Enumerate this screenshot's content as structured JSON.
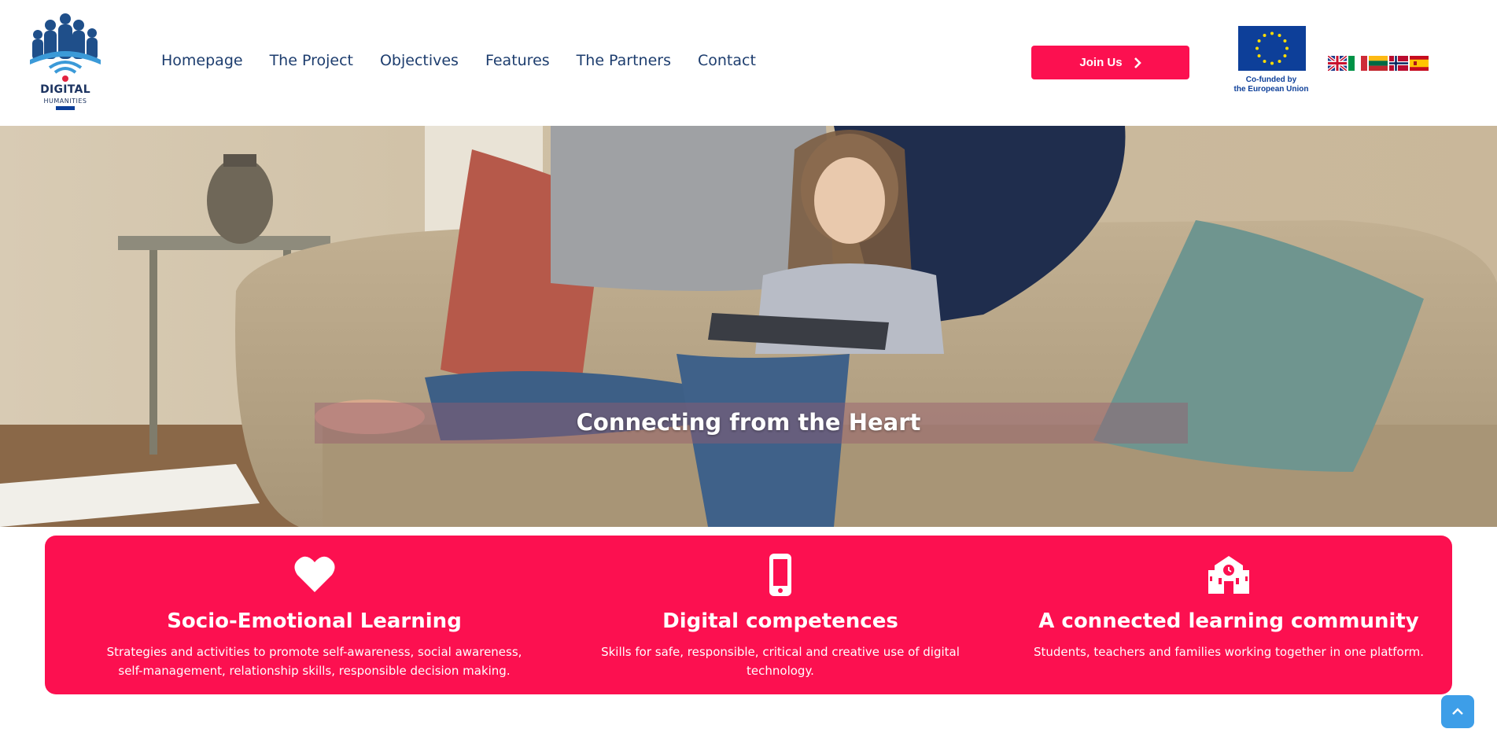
{
  "brand": {
    "logo_line1": "DIGITAL",
    "logo_line2": "HUMANITIES"
  },
  "nav": {
    "items": [
      {
        "label": "Homepage"
      },
      {
        "label": "The Project"
      },
      {
        "label": "Objectives"
      },
      {
        "label": "Features"
      },
      {
        "label": "The Partners"
      },
      {
        "label": "Contact"
      }
    ]
  },
  "header": {
    "join_label": "Join Us",
    "eu_line1": "Co-funded by",
    "eu_line2": "the European Union",
    "languages": [
      "English",
      "Italiano",
      "Lietuvių",
      "Norsk",
      "Español"
    ]
  },
  "hero": {
    "title": "Connecting from the Heart"
  },
  "features": [
    {
      "icon": "heart-icon",
      "title": "Socio-Emotional Learning",
      "text": "Strategies and activities to promote self-awareness, social awareness, self-management, relationship skills, responsible decision making."
    },
    {
      "icon": "mobile-phone-icon",
      "title": "Digital competences",
      "text": "Skills for safe, responsible, critical and creative use of digital technology."
    },
    {
      "icon": "school-icon",
      "title": "A connected learning community",
      "text": "Students, teachers and families working together in one platform."
    }
  ],
  "colors": {
    "accent": "#fc1050",
    "nav_text": "#1d3d6e",
    "eu_blue": "#0d3f99",
    "to_top": "#3d9ee8"
  }
}
